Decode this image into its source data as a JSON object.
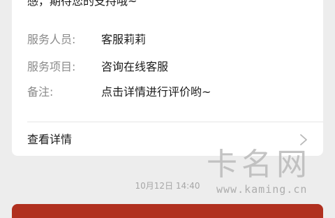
{
  "message_card": {
    "intro_text": "感，期待您的支持哦~",
    "rows": [
      {
        "label": "服务人员:",
        "value": "客服莉莉"
      },
      {
        "label": "服务项目:",
        "value": "咨询在线客服"
      },
      {
        "label": "备注:",
        "value": "点击详情进行评价哟~"
      }
    ],
    "details_label": "查看详情",
    "details_icon": "chevron-right-icon"
  },
  "timestamp": "10月12日 14:40",
  "watermark": {
    "brand_cn": "卡名网",
    "url": "www.kaming.cn"
  },
  "colors": {
    "background": "#ededed",
    "card": "#ffffff",
    "bottom_bar": "#b0301f"
  }
}
